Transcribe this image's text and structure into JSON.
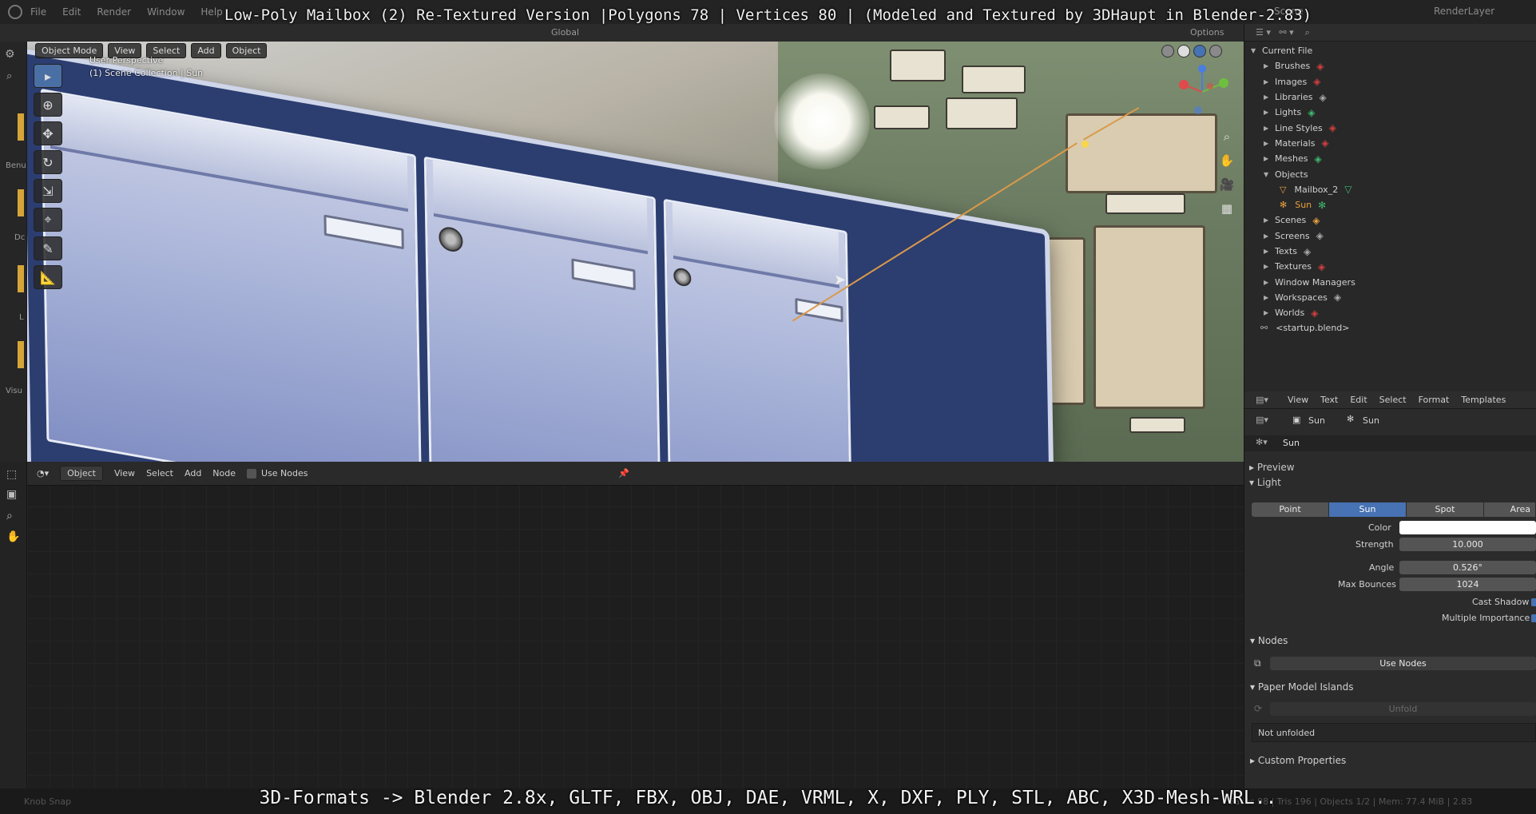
{
  "overlay": {
    "title": "Low-Poly Mailbox (2) Re-Textured Version |Polygons 78 | Vertices 80 | (Modeled and Textured by 3DHaupt in Blender-2.83)",
    "bottom": "3D-Formats -> Blender 2.8x, GLTF, FBX, OBJ, DAE, VRML, X, DXF, PLY, STL, ABC, X3D-Mesh-WRL.."
  },
  "topmenu": [
    "File",
    "Edit",
    "Render",
    "Window",
    "Help"
  ],
  "topright": {
    "scene": "Scene",
    "layer": "RenderLayer"
  },
  "header": {
    "orientation": "Global",
    "options": "Options"
  },
  "left_strip": [
    "Benu",
    "Dc",
    "L",
    "Visu"
  ],
  "viewport": {
    "mode": "Object Mode",
    "menu": [
      "View",
      "Select",
      "Add",
      "Object"
    ],
    "perspective": "User Perspective",
    "collection": "(1) Scene Collection | Sun"
  },
  "node_editor": {
    "type": "Object",
    "menu": [
      "View",
      "Select",
      "Add",
      "Node"
    ],
    "use_nodes": "Use Nodes"
  },
  "status_bar": {
    "left": "Knob Snap",
    "right": "Faces 98 | Tris 196 | Objects 1/2 | Mem: 77.4 MiB | 2.83"
  },
  "outliner": {
    "title": "Current File",
    "items": [
      {
        "label": "Brushes",
        "icon": "brush-icon",
        "color": "#d04040",
        "level": 1
      },
      {
        "label": "Images",
        "icon": "image-icon",
        "color": "#d04040",
        "level": 1
      },
      {
        "label": "Libraries",
        "icon": "link-icon",
        "color": "#aaaaaa",
        "level": 1
      },
      {
        "label": "Lights",
        "icon": "light-icon",
        "color": "#3fb870",
        "level": 1
      },
      {
        "label": "Line Styles",
        "icon": "linestyle-icon",
        "color": "#d04040",
        "level": 1
      },
      {
        "label": "Materials",
        "icon": "material-icon",
        "color": "#d04040",
        "level": 1
      },
      {
        "label": "Meshes",
        "icon": "mesh-icon",
        "color": "#3fb870",
        "level": 1
      },
      {
        "label": "Objects",
        "icon": "",
        "color": "",
        "level": 1
      },
      {
        "label": "Mailbox_2",
        "icon": "mesh-object-icon",
        "color": "#e8a040",
        "level": 2
      },
      {
        "label": "Sun",
        "icon": "sun-object-icon",
        "color": "#e8a040",
        "level": 2
      },
      {
        "label": "Scenes",
        "icon": "scene-icon",
        "color": "#e8a040",
        "level": 1
      },
      {
        "label": "Screens",
        "icon": "screen-icon",
        "color": "#aaaaaa",
        "level": 1
      },
      {
        "label": "Texts",
        "icon": "text-icon",
        "color": "#aaaaaa",
        "level": 1
      },
      {
        "label": "Textures",
        "icon": "texture-icon",
        "color": "#d04040",
        "level": 1
      },
      {
        "label": "Window Managers",
        "icon": "",
        "color": "",
        "level": 1
      },
      {
        "label": "Workspaces",
        "icon": "workspace-icon",
        "color": "#aaaaaa",
        "level": 1
      },
      {
        "label": "Worlds",
        "icon": "world-icon",
        "color": "#d04040",
        "level": 1
      },
      {
        "label": "<startup.blend>",
        "icon": "link-icon",
        "color": "#aaaaaa",
        "level": 0
      }
    ]
  },
  "text_menu": [
    "View",
    "Text",
    "Edit",
    "Select",
    "Format",
    "Templates"
  ],
  "properties": {
    "crumb_object": "Sun",
    "crumb_data": "Sun",
    "name_field": "Sun",
    "preview": "Preview",
    "light": "Light",
    "light_types": [
      "Point",
      "Sun",
      "Spot",
      "Area"
    ],
    "active_type": "Sun",
    "color_label": "Color",
    "strength_label": "Strength",
    "strength": "10.000",
    "angle_label": "Angle",
    "angle": "0.526°",
    "bounces_label": "Max Bounces",
    "bounces": "1024",
    "cast_shadow": "Cast Shadow",
    "multiple_importance": "Multiple Importance",
    "nodes": "Nodes",
    "use_nodes": "Use Nodes",
    "paper_model": "Paper Model Islands",
    "unfold": "Unfold",
    "not_unfolded": "Not unfolded",
    "custom_props": "Custom Properties"
  }
}
